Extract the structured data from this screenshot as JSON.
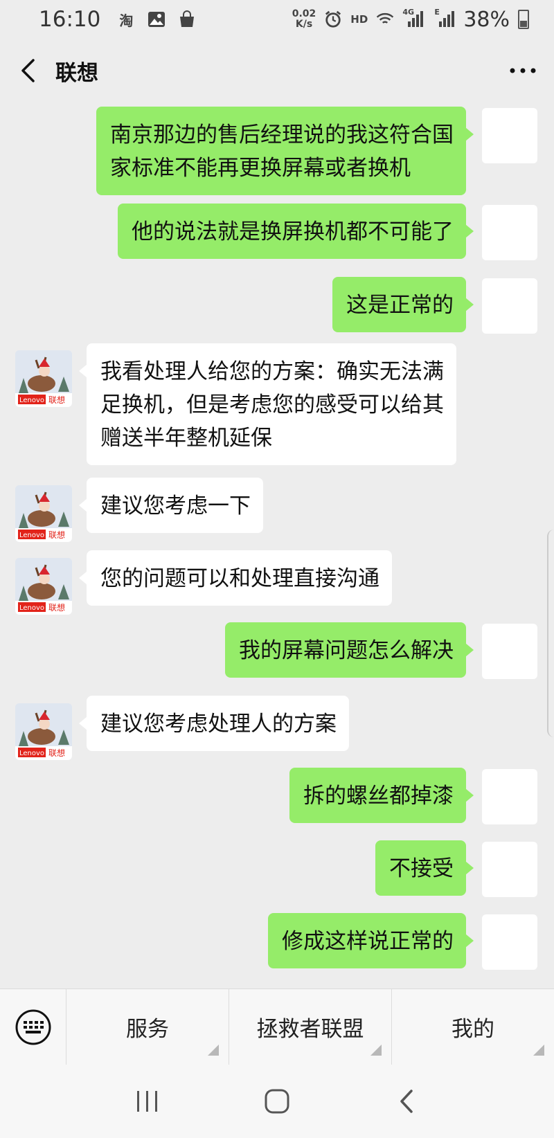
{
  "status_bar": {
    "time": "16:10",
    "app_icons": [
      "taobao-icon",
      "gallery-icon",
      "shopping-bag-icon"
    ],
    "net_speed_value": "0.02",
    "net_speed_unit": "K/s",
    "hd_label": "HD",
    "net_4g": "4G",
    "net_e": "E",
    "battery_percent": "38%"
  },
  "header": {
    "title": "联想",
    "back_icon": "chevron-left-icon",
    "more_icon": "more-dots-icon"
  },
  "messages": [
    {
      "side": "self",
      "text_lines": [
        "南京那边的售后经理说的我这符合国",
        "家标准不能再更换屏幕或者换机"
      ]
    },
    {
      "side": "self",
      "text_lines": [
        "他的说法就是换屏换机都不可能了"
      ]
    },
    {
      "side": "self",
      "text_lines": [
        "这是正常的"
      ]
    },
    {
      "side": "other",
      "text_lines": [
        "我看处理人给您的方案：确实无法满",
        "足换机，但是考虑您的感受可以给其",
        "赠送半年整机延保"
      ]
    },
    {
      "side": "other",
      "text_lines": [
        "建议您考虑一下"
      ]
    },
    {
      "side": "other",
      "text_lines": [
        "您的问题可以和处理直接沟通"
      ]
    },
    {
      "side": "self",
      "text_lines": [
        "我的屏幕问题怎么解决"
      ]
    },
    {
      "side": "other",
      "text_lines": [
        "建议您考虑处理人的方案"
      ]
    },
    {
      "side": "self",
      "text_lines": [
        "拆的螺丝都掉漆"
      ]
    },
    {
      "side": "self",
      "text_lines": [
        "不接受"
      ]
    },
    {
      "side": "self",
      "text_lines": [
        "修成这样说正常的"
      ]
    }
  ],
  "avatar_other": {
    "brand_text": "Lenovo",
    "brand_cn": "联想"
  },
  "menu": {
    "keyboard_icon": "keyboard-icon",
    "items": [
      "服务",
      "拯救者联盟",
      "我的"
    ]
  },
  "nav": {
    "icons": [
      "recent-apps-icon",
      "home-icon",
      "back-icon"
    ]
  },
  "colors": {
    "background": "#ededed",
    "self_bubble": "#95ec69",
    "other_bubble": "#ffffff"
  }
}
